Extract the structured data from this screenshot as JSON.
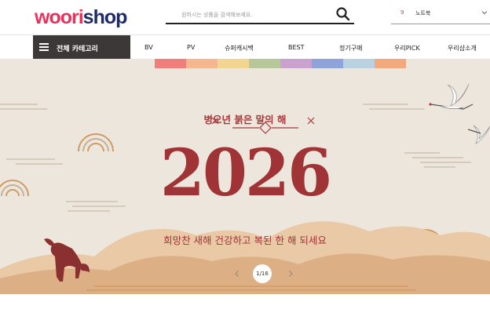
{
  "header": {
    "logo": {
      "part1": "woori",
      "part2": "shop"
    },
    "search": {
      "placeholder": "원하시는 상품을 검색해보세요.",
      "value": ""
    },
    "recent": {
      "count": "9",
      "label": "노트북"
    }
  },
  "nav": {
    "all_categories": "전체 카테고리",
    "items": [
      "BV",
      "PV",
      "슈퍼캐시백",
      "BEST",
      "정기구매",
      "우리PICK",
      "우리샵소개"
    ]
  },
  "banner": {
    "tagline": "병오년 붉은 말의 해",
    "year": "2026",
    "greeting": "희망찬 새해 건강하고 복된 한 해 되세요",
    "pager": "1/16"
  },
  "colors": {
    "accent": "#e8315b",
    "brand_navy": "#1e2b6a",
    "banner_bg": "#ede6dc",
    "banner_red": "#a03335",
    "nav_dark": "#3c3838",
    "ribbons": [
      "#f07f7c",
      "#f5b78e",
      "#f2d591",
      "#b7c79a",
      "#c9a2cf",
      "#8ea3d9",
      "#b9d1e0",
      "#f2a97e"
    ]
  }
}
